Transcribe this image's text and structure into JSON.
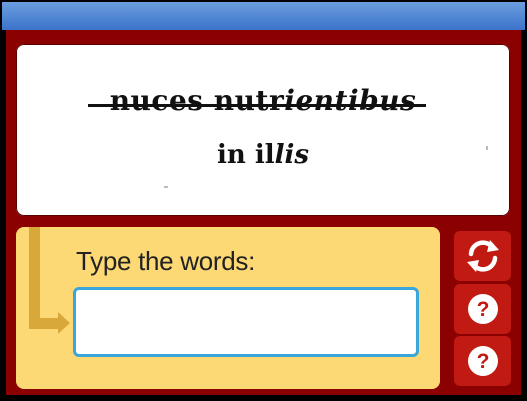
{
  "challenge": {
    "line1_normal": "nuces nutr",
    "line1_italic": "ientibus",
    "line2_normal": "in il",
    "line2_italic": "lis"
  },
  "entry": {
    "prompt": "Type the words:",
    "input_value": ""
  },
  "buttons": [
    {
      "icon": "refresh-icon",
      "label": ""
    },
    {
      "icon": "help-icon",
      "label": "?"
    },
    {
      "icon": "help-icon",
      "label": "?"
    }
  ],
  "colors": {
    "frame": "#8b0000",
    "entry_bg": "#fcd974",
    "button": "#c11a12",
    "input_border": "#3aa6d9",
    "topbar": "#3b73c9"
  }
}
